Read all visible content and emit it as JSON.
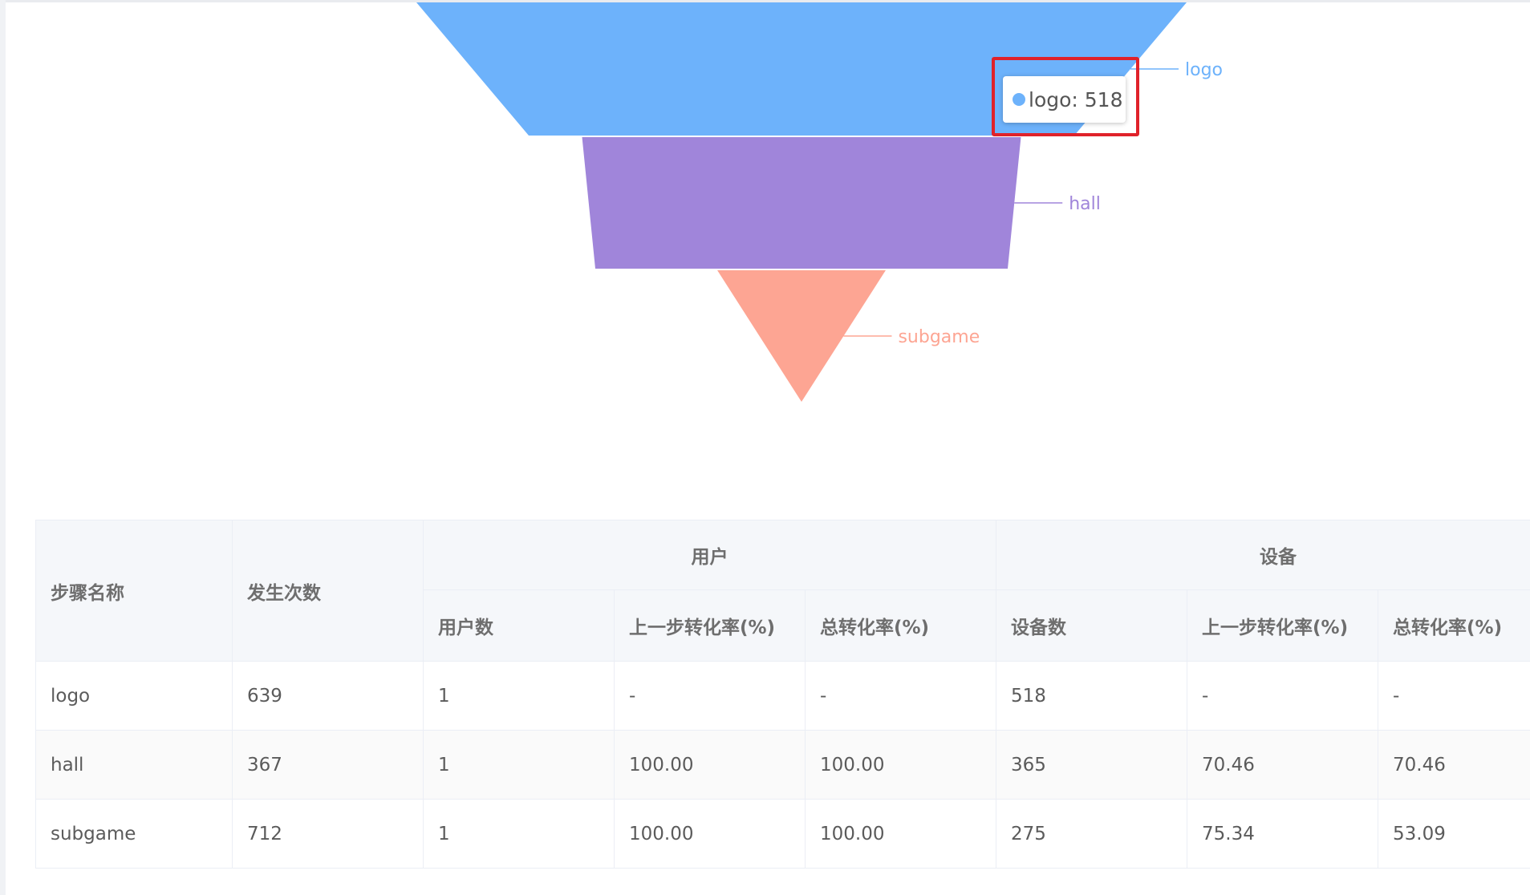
{
  "chart_data": {
    "type": "funnel",
    "categories": [
      "logo",
      "hall",
      "subgame"
    ],
    "values": [
      518,
      365,
      275
    ],
    "colors": [
      "#6db2fb",
      "#a085da",
      "#fda593"
    ],
    "tooltip": {
      "category": "logo",
      "value": 518,
      "text": "logo: 518"
    }
  },
  "table": {
    "headers": {
      "step_name": "步骤名称",
      "occurrences": "发生次数",
      "group_users": "用户",
      "group_devices": "设备",
      "user_count": "用户数",
      "user_prev_rate": "上一步转化率(%)",
      "user_total_rate": "总转化率(%)",
      "device_count": "设备数",
      "device_prev_rate": "上一步转化率(%)",
      "device_total_rate": "总转化率(%)"
    },
    "rows": [
      {
        "step": "logo",
        "occurrences": "639",
        "users": "1",
        "user_prev": "-",
        "user_total": "-",
        "devices": "518",
        "device_prev": "-",
        "device_total": "-"
      },
      {
        "step": "hall",
        "occurrences": "367",
        "users": "1",
        "user_prev": "100.00",
        "user_total": "100.00",
        "devices": "365",
        "device_prev": "70.46",
        "device_total": "70.46"
      },
      {
        "step": "subgame",
        "occurrences": "712",
        "users": "1",
        "user_prev": "100.00",
        "user_total": "100.00",
        "devices": "275",
        "device_prev": "75.34",
        "device_total": "53.09"
      }
    ]
  }
}
